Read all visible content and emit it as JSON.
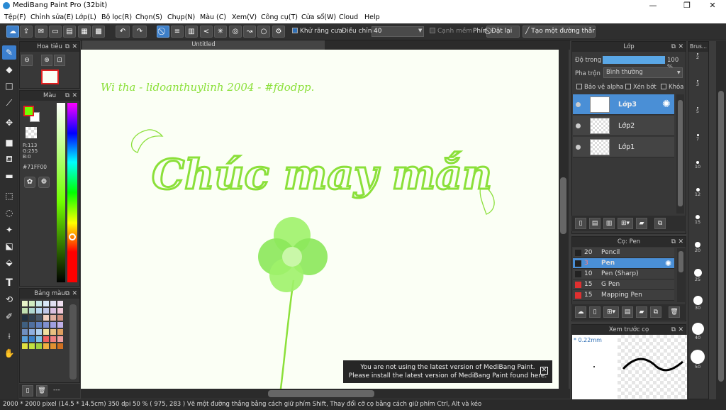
{
  "app": {
    "title": "MediBang Paint Pro (32bit)"
  },
  "window_controls": {
    "minimize": "—",
    "maximize": "❐",
    "close": "✕"
  },
  "menu": [
    "Tệp(F)",
    "Chỉnh sửa(E)",
    "Lớp(L)",
    "Bộ lọc(R)",
    "Chọn(S)",
    "Chụp(N)",
    "Màu (C)",
    "Xem(V)",
    "Công cụ(T)",
    "Cửa sổ(W)",
    "Cloud",
    "Help"
  ],
  "toolbar": {
    "antialias": "Khử răng cưa",
    "adjust_label": "Điều chỉnh",
    "adjust_value": "40",
    "smooth_edge": "Cạnh mềm",
    "key_label": "Phím",
    "set_button": "Đặt lại",
    "straight_line_button": "Tạo một đường thẳng"
  },
  "navigator": {
    "title": "Hoa tiêu"
  },
  "color_panel": {
    "title": "Màu",
    "r": "R:113",
    "g": "G:255",
    "b": "B:0",
    "hex": "#71FF00",
    "foreground": "#71ff00",
    "background": "#ffffff"
  },
  "palette": {
    "title": "Bảng màu",
    "more": "---"
  },
  "canvas": {
    "tab": "Untitled",
    "line_text": "Wi tha - lidoanthuylinh 2004 - #fdodpp.",
    "main_text": "Chúc may mắn",
    "ink_color": "#8be03a"
  },
  "notice": {
    "line1": "You are not using the latest version of MediBang Paint.",
    "line2": "Please install the latest version of MediBang Paint found here.",
    "close": "✕"
  },
  "layers": {
    "title": "Lớp",
    "opacity_label": "Độ trong",
    "opacity_value": "100 %",
    "blend_label": "Pha trộn",
    "blend_value": "Bình thường",
    "protect_alpha": "Bảo vệ alpha",
    "clipping": "Xén bớt",
    "lock": "Khóa",
    "items": [
      {
        "name": "Lớp3",
        "selected": true
      },
      {
        "name": "Lớp2",
        "selected": false
      },
      {
        "name": "Lớp1",
        "selected": false
      }
    ]
  },
  "brush_panel": {
    "title": "Cọ: Pen",
    "items": [
      {
        "size": "20",
        "name": "Pencil",
        "color": "#222222",
        "selected": false
      },
      {
        "size": "3",
        "name": "Pen",
        "color": "#222222",
        "selected": true
      },
      {
        "size": "10",
        "name": "Pen (Sharp)",
        "color": "#222222",
        "selected": false
      },
      {
        "size": "15",
        "name": "G Pen",
        "color": "#e03030",
        "selected": false
      },
      {
        "size": "15",
        "name": "Mapping Pen",
        "color": "#e03030",
        "selected": false
      }
    ]
  },
  "brush_preview": {
    "title": "Xem trước cọ",
    "size": "* 0.22mm"
  },
  "brush_sizes": {
    "title": "Brus...",
    "sizes": [
      "2",
      "3",
      "5",
      "7",
      "10",
      "12",
      "15",
      "20",
      "25",
      "30",
      "40",
      "50"
    ]
  },
  "status": {
    "text": "2000 * 2000 pixel  (14.5 * 14.5cm)  350 dpi  50 %  ( 975, 283 )  Vẽ một đường thẳng bằng cách giữ phím Shift, Thay đổi cỡ cọ bằng cách giữ phím Ctrl, Alt và kéo"
  }
}
